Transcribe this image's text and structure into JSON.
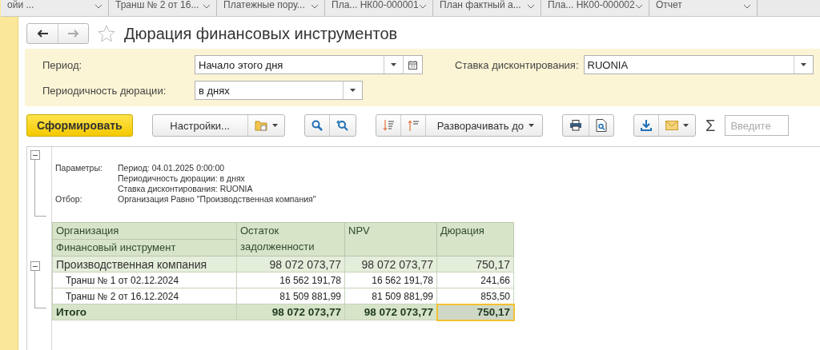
{
  "tabs": [
    {
      "label": "ойи ...",
      "selected": false
    },
    {
      "label": "Транш № 2 от 16...",
      "selected": false
    },
    {
      "label": "Платежные пору...",
      "selected": false
    },
    {
      "label": "Пла... НК00-000001",
      "selected": false
    },
    {
      "label": "План фактный а...",
      "selected": false
    },
    {
      "label": "Пла... НК00-000002",
      "selected": false
    },
    {
      "label": "Отчет",
      "selected": false
    }
  ],
  "window": {
    "title": "Дюрация финансовых инструментов",
    "favorite": false
  },
  "filters": {
    "period": {
      "label": "Период:",
      "value": "Начало этого дня"
    },
    "rate": {
      "label": "Ставка дисконтирования:",
      "value": "RUONIA"
    },
    "periodicity": {
      "label": "Периодичность дюрации:",
      "value": "в днях"
    }
  },
  "toolbar": {
    "generate": "Сформировать",
    "settings": "Настройки...",
    "expand_to": "Разворачивать до",
    "sum": "Σ",
    "search": {
      "placeholder": "Введите"
    }
  },
  "report": {
    "params_expanded": true,
    "params": [
      {
        "key": "Параметры:",
        "value": "Период: 04.01.2025 0:00:00"
      },
      {
        "value": "Периодичность дюрации: в днях"
      },
      {
        "value": "Ставка дисконтирования: RUONIA"
      },
      {
        "key": "Отбор:",
        "value": "Организация Равно \"Производственная компания\""
      }
    ],
    "columns": [
      {
        "lines": [
          "Организация",
          "Финансовый инструмент"
        ]
      },
      {
        "lines": [
          "Остаток",
          "задолженности"
        ]
      },
      {
        "lines": [
          "NPV"
        ]
      },
      {
        "lines": [
          "Дюрация"
        ]
      }
    ],
    "rows": [
      {
        "kind": "group",
        "expanded": true,
        "label": "Производственная компания",
        "values": [
          {
            "text": "98 072 073,77",
            "selected": false
          },
          {
            "text": "98 072 073,77",
            "selected": false
          },
          {
            "text": "750,17",
            "selected": false
          }
        ]
      },
      {
        "kind": "item",
        "label": "Транш № 1 от 02.12.2024",
        "values": [
          {
            "text": "16 562 191,78",
            "selected": false
          },
          {
            "text": "16 562 191,78",
            "selected": false
          },
          {
            "text": "241,66",
            "selected": false
          }
        ]
      },
      {
        "kind": "item",
        "label": "Транш № 2 от 16.12.2024",
        "values": [
          {
            "text": "81 509 881,99",
            "selected": false
          },
          {
            "text": "81 509 881,99",
            "selected": false
          },
          {
            "text": "853,50",
            "selected": false
          }
        ]
      },
      {
        "kind": "total",
        "label": "Итого",
        "values": [
          {
            "text": "98 072 073,77",
            "selected": false
          },
          {
            "text": "98 072 073,77",
            "selected": false
          },
          {
            "text": "750,17",
            "selected": true
          }
        ]
      }
    ]
  }
}
